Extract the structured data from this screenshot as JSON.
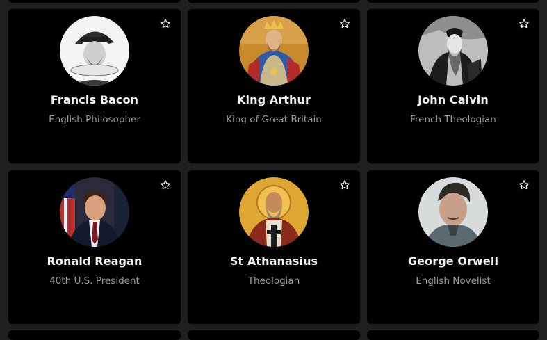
{
  "people": [
    {
      "name": "Francis Bacon",
      "title": "English Philosopher"
    },
    {
      "name": "King Arthur",
      "title": "King of Great Britain"
    },
    {
      "name": "John Calvin",
      "title": "French Theologian"
    },
    {
      "name": "Ronald Reagan",
      "title": "40th U.S. President"
    },
    {
      "name": "St Athanasius",
      "title": "Theologian"
    },
    {
      "name": "George Orwell",
      "title": "English Novelist"
    }
  ],
  "icons": {
    "favorite": "star-outline-icon"
  },
  "colors": {
    "page_background": "#1d1f21",
    "card_background": "#000000",
    "name_text": "#f2f2f2",
    "subtitle_text": "#9a9a9a"
  }
}
